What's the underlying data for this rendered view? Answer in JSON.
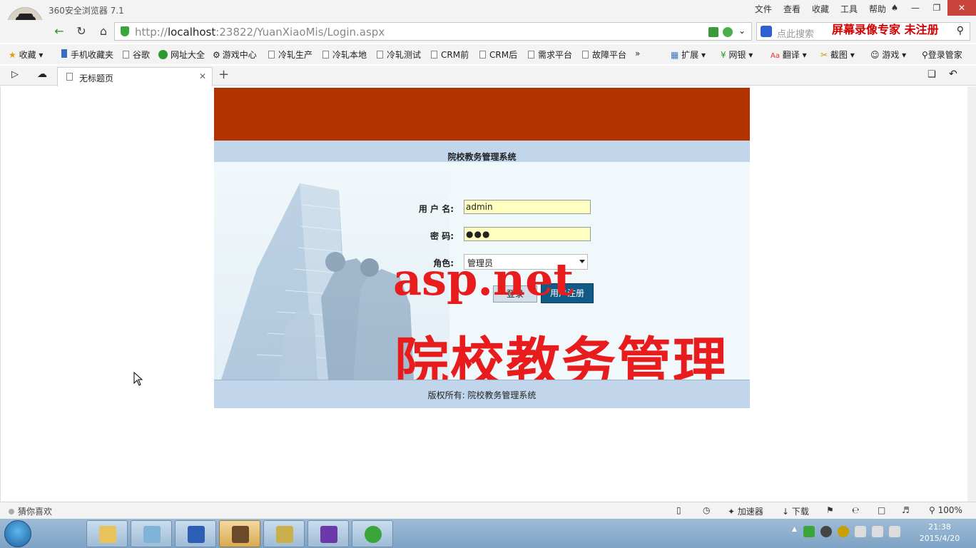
{
  "browser": {
    "app_title": "360安全浏览器 7.1",
    "menu": [
      "文件",
      "查看",
      "收藏",
      "工具",
      "帮助"
    ],
    "url_prefix": "http://",
    "url_host": "localhost",
    "url_rest": ":23822/YuanXiaoMis/Login.aspx",
    "search_placeholder": "点此搜索",
    "recorder_watermark": "屏幕录像专家  未注册",
    "bookmarks": [
      "收藏",
      "手机收藏夹",
      "谷歌",
      "网址大全",
      "游戏中心",
      "冷轧生产",
      "冷轧本地",
      "冷轧测试",
      "CRM前",
      "CRM后",
      "需求平台",
      "故障平台"
    ],
    "bookmark_tools": [
      "扩展",
      "网银",
      "翻译",
      "截图",
      "游戏",
      "登录管家"
    ],
    "tab_title": "无标题页"
  },
  "page": {
    "system_title": "院校教务管理系统",
    "username_label": "用 户 名:",
    "username_value": "admin",
    "password_label": "密 码:",
    "password_value": "●●●",
    "role_label": "角色:",
    "role_value": "管理员",
    "login_button": "登录",
    "register_button": "用户注册",
    "watermark_line1": "asp.net",
    "watermark_line2": "院校教务管理",
    "footer_text": "版权所有:  院校教务管理系统"
  },
  "statusbar": {
    "left_text": "猜你喜欢",
    "accelerator": "加速器",
    "download": "下载",
    "zoom": "100%"
  },
  "taskbar": {
    "time": "21:38",
    "date": "2015/4/20"
  }
}
